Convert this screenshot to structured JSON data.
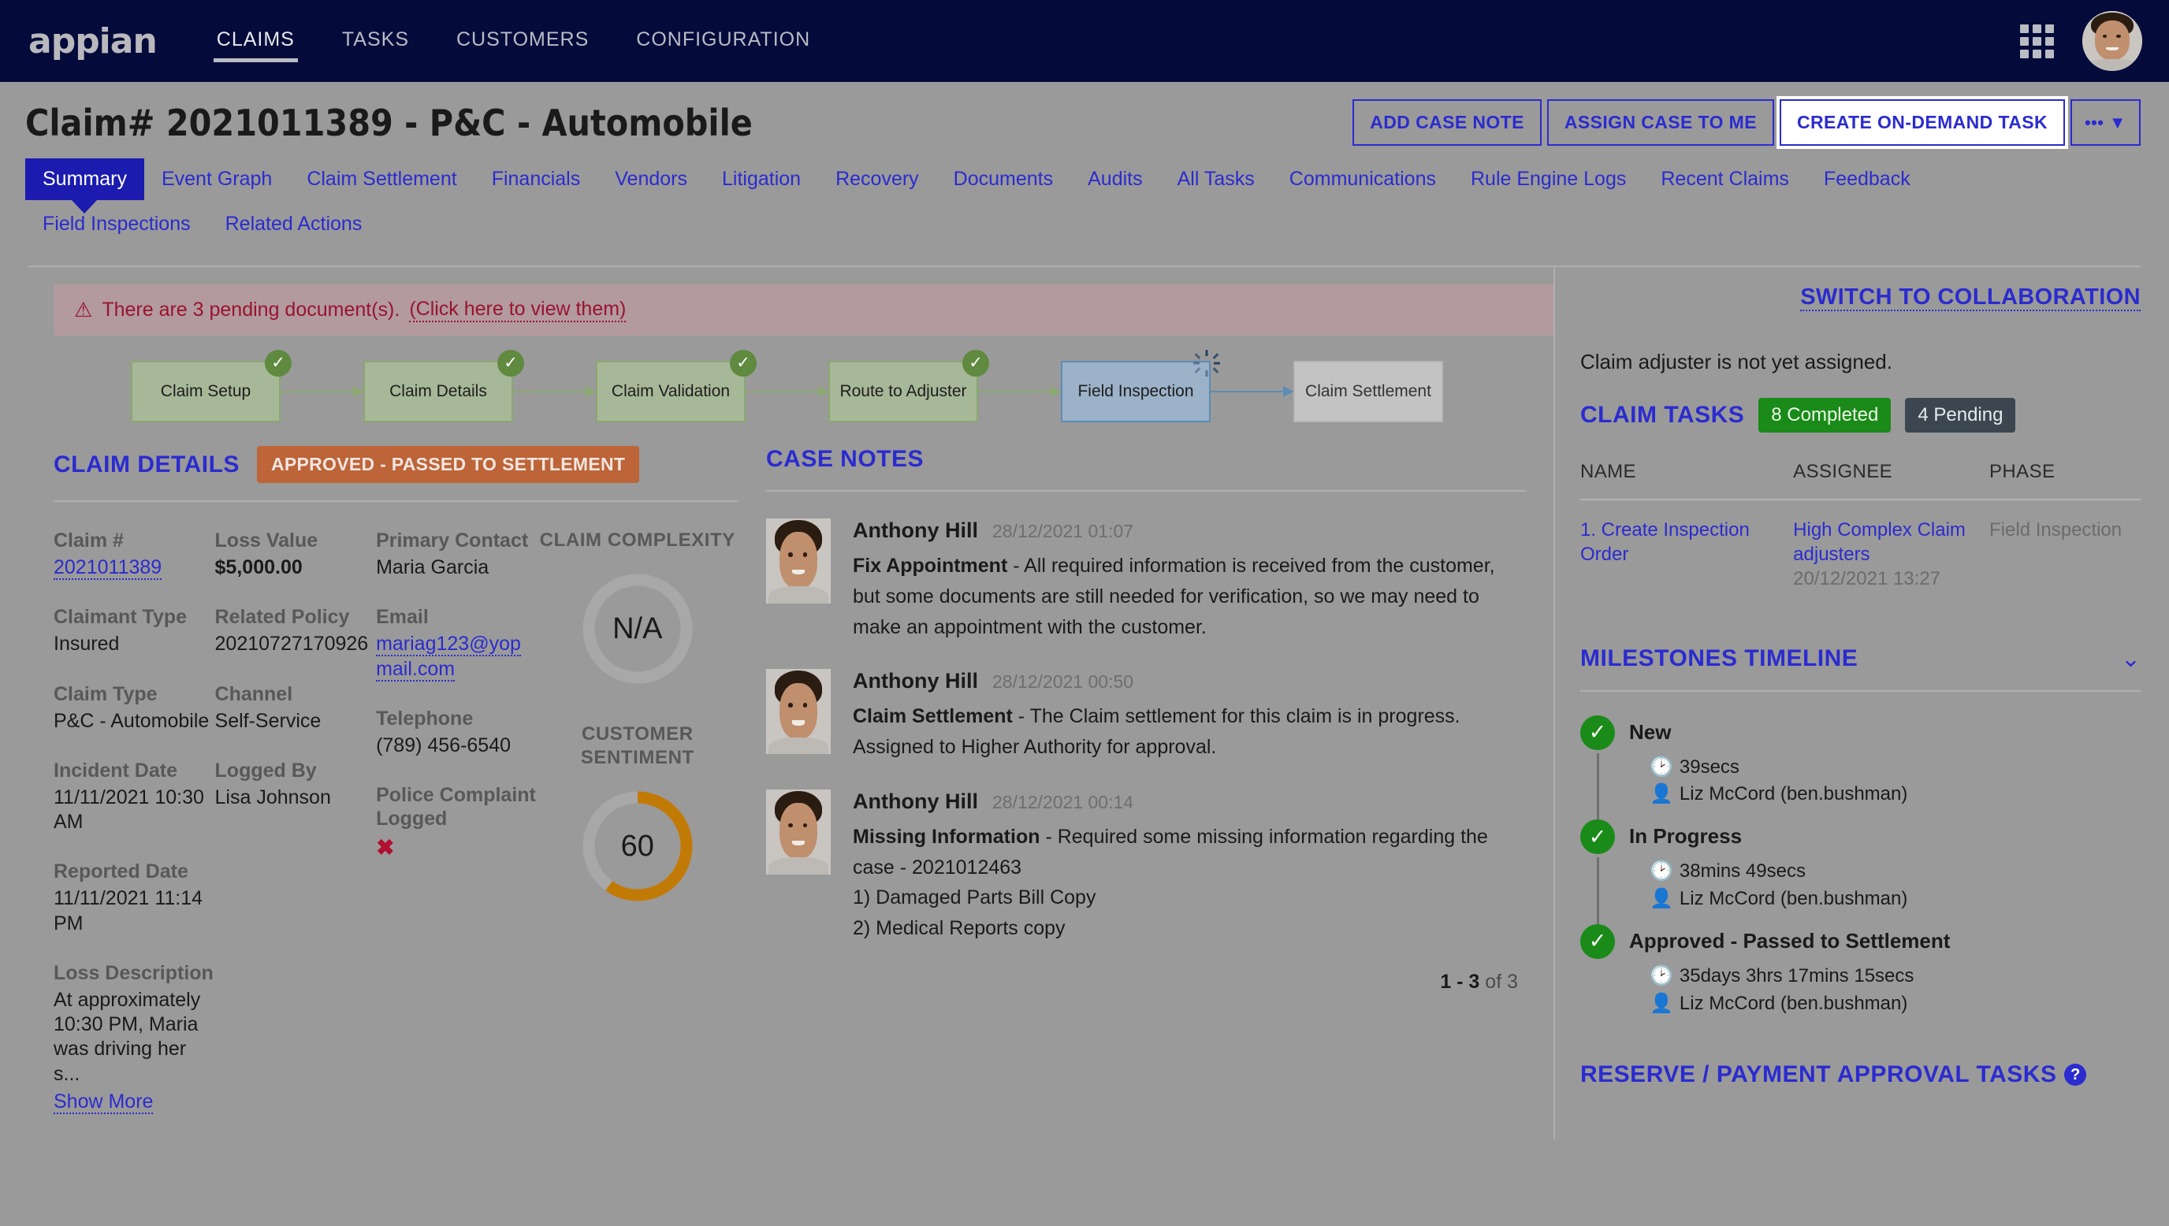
{
  "topnav": {
    "brand": "appian",
    "items": [
      {
        "label": "CLAIMS",
        "active": true
      },
      {
        "label": "TASKS",
        "active": false
      },
      {
        "label": "CUSTOMERS",
        "active": false
      },
      {
        "label": "CONFIGURATION",
        "active": false
      }
    ]
  },
  "header": {
    "title": "Claim# 2021011389 - P&C - Automobile",
    "buttons": [
      {
        "label": "ADD CASE NOTE"
      },
      {
        "label": "ASSIGN CASE TO ME"
      },
      {
        "label": "CREATE ON-DEMAND TASK"
      }
    ],
    "more_label": "••• ▼"
  },
  "tabs": [
    {
      "label": "Summary",
      "active": true
    },
    {
      "label": "Event Graph",
      "active": false
    },
    {
      "label": "Claim Settlement",
      "active": false
    },
    {
      "label": "Financials",
      "active": false
    },
    {
      "label": "Vendors",
      "active": false
    },
    {
      "label": "Litigation",
      "active": false
    },
    {
      "label": "Recovery",
      "active": false
    },
    {
      "label": "Documents",
      "active": false
    },
    {
      "label": "Audits",
      "active": false
    },
    {
      "label": "All Tasks",
      "active": false
    },
    {
      "label": "Communications",
      "active": false
    },
    {
      "label": "Rule Engine Logs",
      "active": false
    },
    {
      "label": "Recent Claims",
      "active": false
    },
    {
      "label": "Feedback",
      "active": false
    },
    {
      "label": "Field Inspections",
      "active": false
    },
    {
      "label": "Related Actions",
      "active": false
    }
  ],
  "alert": {
    "text": "There are 3 pending document(s).",
    "link": "(Click here to view them)"
  },
  "flow": {
    "nodes": [
      {
        "label": "Claim Setup",
        "state": "done"
      },
      {
        "label": "Claim Details",
        "state": "done"
      },
      {
        "label": "Claim Validation",
        "state": "done"
      },
      {
        "label": "Route to Adjuster",
        "state": "done"
      },
      {
        "label": "Field Inspection",
        "state": "current"
      },
      {
        "label": "Claim Settlement",
        "state": "future"
      }
    ]
  },
  "claim_details": {
    "title": "CLAIM DETAILS",
    "status": "APPROVED - PASSED TO SETTLEMENT",
    "col1": [
      {
        "label": "Claim #",
        "value": "2021011389",
        "link": true
      },
      {
        "label": "Claimant Type",
        "value": "Insured"
      },
      {
        "label": "Claim Type",
        "value": "P&C - Automobile"
      },
      {
        "label": "Incident Date",
        "value": "11/11/2021 10:30 AM"
      },
      {
        "label": "Reported Date",
        "value": "11/11/2021 11:14 PM"
      },
      {
        "label": "Loss Description",
        "value": "At approximately 10:30 PM, Maria was driving her s...",
        "more": "Show More"
      }
    ],
    "col2": [
      {
        "label": "Loss Value",
        "value": "$5,000.00",
        "bold": true
      },
      {
        "label": "Related Policy",
        "value": "20210727170926"
      },
      {
        "label": "Channel",
        "value": "Self-Service"
      },
      {
        "label": "Logged By",
        "value": "Lisa Johnson"
      }
    ],
    "col3": [
      {
        "label": "Primary Contact",
        "value": "Maria Garcia"
      },
      {
        "label": "Email",
        "value": "mariag123@yopmail.com",
        "link": true
      },
      {
        "label": "Telephone",
        "value": "(789) 456-6540"
      },
      {
        "label": "Police Complaint Logged",
        "value": "✖",
        "xmark": true
      }
    ],
    "gauges": [
      {
        "label": "CLAIM COMPLEXITY",
        "value": "N/A",
        "percent": 0,
        "color": "#a8a8a8"
      },
      {
        "label": "CUSTOMER SENTIMENT",
        "value": "60",
        "percent": 60,
        "color": "#c27a07"
      }
    ]
  },
  "case_notes": {
    "title": "CASE NOTES",
    "notes": [
      {
        "author": "Anthony Hill",
        "time": "28/12/2021 01:07",
        "subject": "Fix Appointment",
        "text": " - All required information is received from the customer, but some documents are still needed for verification, so we may need to make an appointment with the customer."
      },
      {
        "author": "Anthony Hill",
        "time": "28/12/2021 00:50",
        "subject": "Claim Settlement",
        "text": " - The Claim settlement for this claim is in progress. Assigned to Higher Authority for approval."
      },
      {
        "author": "Anthony Hill",
        "time": "28/12/2021 00:14",
        "subject": "Missing Information",
        "text": " - Required some missing information regarding the case - 2021012463\n1) Damaged Parts Bill Copy\n2) Medical Reports copy"
      }
    ],
    "pager_range": "1 - 3",
    "pager_total": "of 3"
  },
  "sidebar": {
    "collaboration_link": "SWITCH TO COLLABORATION",
    "adjuster_note": "Claim adjuster is not yet assigned.",
    "tasks_title": "CLAIM TASKS",
    "completed_badge": "8 Completed",
    "pending_badge": "4 Pending",
    "table_headers": [
      "NAME",
      "ASSIGNEE",
      "PHASE"
    ],
    "rows": [
      {
        "name": "1. Create Inspection Order",
        "assignee": "High Complex Claim adjusters",
        "assignee_time": "20/12/2021 13:27",
        "phase": "Field Inspection"
      }
    ],
    "milestones_title": "MILESTONES TIMELINE",
    "milestones": [
      {
        "name": "New",
        "duration": "39secs",
        "user": "Liz McCord (ben.bushman)"
      },
      {
        "name": "In Progress",
        "duration": "38mins 49secs",
        "user": "Liz McCord (ben.bushman)"
      },
      {
        "name": "Approved - Passed to Settlement",
        "duration": "35days 3hrs 17mins 15secs",
        "user": "Liz McCord (ben.bushman)"
      }
    ],
    "reserve_title": "RESERVE / PAYMENT APPROVAL TASKS"
  }
}
